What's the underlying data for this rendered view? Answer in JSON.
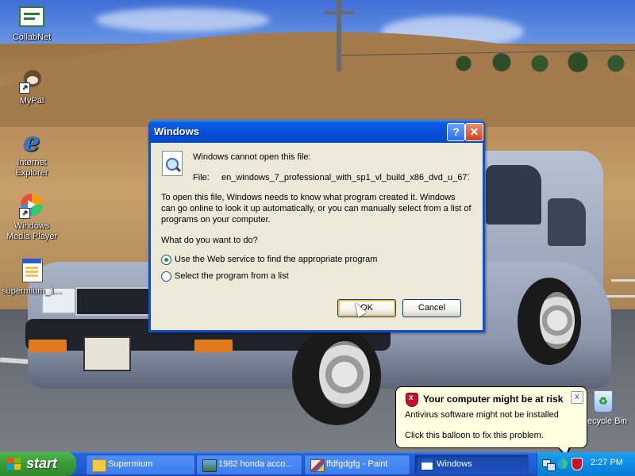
{
  "desktop_icons": [
    {
      "label": "CollabNet",
      "icon": "collabnet-icon"
    },
    {
      "label": "MyPal",
      "icon": "mypal-icon"
    },
    {
      "label": "Internet Explorer",
      "icon": "internet-explorer-icon"
    },
    {
      "label": "Windows Media Player",
      "icon": "windows-media-player-icon"
    },
    {
      "label": "supermium_1...",
      "icon": "installer-icon"
    }
  ],
  "recycle_bin": {
    "label": "ecycle Bin"
  },
  "dialog": {
    "title": "Windows",
    "cannot_open": "Windows cannot open this file:",
    "file_label": "File:",
    "file_name": "en_windows_7_professional_with_sp1_vl_build_x86_dvd_u_677",
    "explain_1": "To open this file, Windows needs to know what program created it.  Windows",
    "explain_2": "can go online to look it up automatically, or you can manually select from a list of",
    "explain_3": "programs on your computer.",
    "question": "What do you want to do?",
    "option_web": "Use the Web service to find the appropriate program",
    "option_list": "Select the program from a list",
    "ok_label": "OK",
    "cancel_label": "Cancel"
  },
  "balloon": {
    "title": "Your computer might be at risk",
    "line1": "Antivirus software might not be installed",
    "line2": "Click this balloon to fix this problem.",
    "close": "x"
  },
  "taskbar": {
    "start_label": "start",
    "tasks": [
      {
        "label": "Supermium",
        "icon": "folder-icon"
      },
      {
        "label": "1982 honda acco...",
        "icon": "image-viewer-icon"
      },
      {
        "label": "ffdfgdgfg - Paint",
        "icon": "paint-icon"
      },
      {
        "label": "Windows",
        "icon": "window-icon"
      }
    ],
    "clock": "2:27 PM"
  },
  "colors": {
    "title_blue": "#0550d8",
    "start_green": "#3a9d3a",
    "taskbar_blue": "#245edb",
    "balloon_bg": "#ffffe1",
    "dialog_bg": "#ece9d8"
  }
}
